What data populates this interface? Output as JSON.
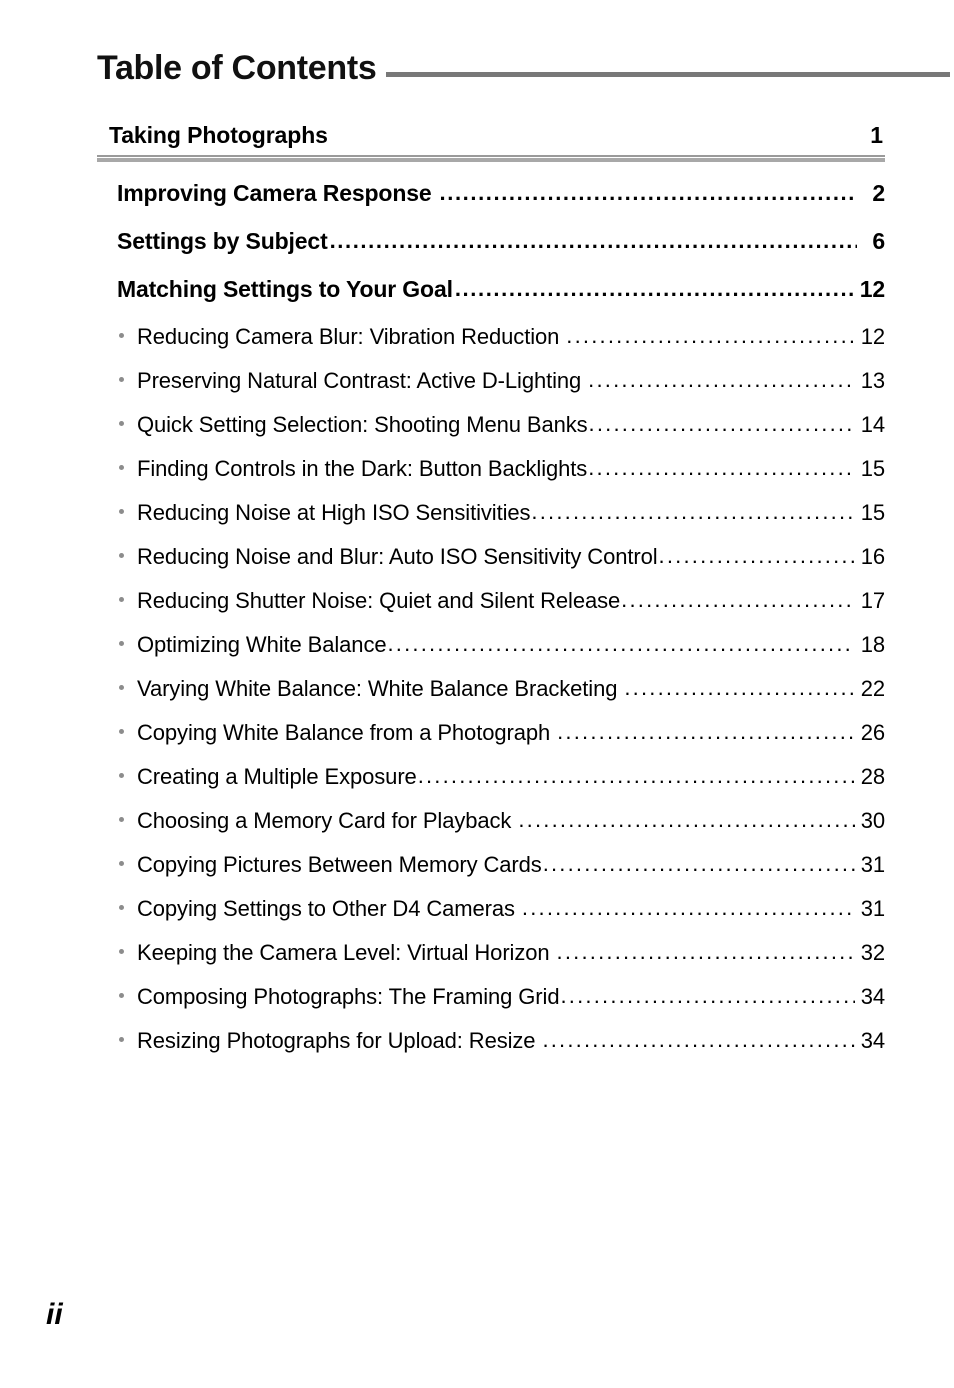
{
  "document": {
    "title": "Table of Contents",
    "folio": "ii"
  },
  "colors": {
    "header_rule": "#787878",
    "section_rule_thin": "#9a9a9a",
    "section_rule_thick": "#a8a8a8",
    "bullet": "#8c8c8c",
    "text": "#000000",
    "background": "#ffffff"
  },
  "section": {
    "title": "Taking Photographs",
    "page": "1"
  },
  "entries": [
    {
      "level": 2,
      "label": "Improving Camera Response",
      "page": "2",
      "gap": true
    },
    {
      "level": 2,
      "label": "Settings by Subject",
      "page": "6",
      "gap": false
    },
    {
      "level": 2,
      "label": "Matching Settings to Your Goal",
      "page": "12",
      "gap": false
    },
    {
      "level": 3,
      "label": "Reducing Camera Blur: Vibration Reduction",
      "page": "12",
      "gap": true
    },
    {
      "level": 3,
      "label": "Preserving Natural Contrast: Active D-Lighting",
      "page": "13",
      "gap": true
    },
    {
      "level": 3,
      "label": "Quick Setting Selection: Shooting Menu Banks",
      "page": "14",
      "gap": false
    },
    {
      "level": 3,
      "label": "Finding Controls in the Dark: Button Backlights",
      "page": "15",
      "gap": false
    },
    {
      "level": 3,
      "label": "Reducing Noise at High ISO Sensitivities",
      "page": "15",
      "gap": false
    },
    {
      "level": 3,
      "label": "Reducing Noise and Blur: Auto ISO Sensitivity Control",
      "page": "16",
      "gap": false
    },
    {
      "level": 3,
      "label": "Reducing Shutter Noise: Quiet and Silent Release",
      "page": "17",
      "gap": false
    },
    {
      "level": 3,
      "label": "Optimizing White Balance",
      "page": "18",
      "gap": false
    },
    {
      "level": 3,
      "label": "Varying White Balance: White Balance Bracketing",
      "page": "22",
      "gap": true
    },
    {
      "level": 3,
      "label": "Copying White Balance from a Photograph",
      "page": "26",
      "gap": true
    },
    {
      "level": 3,
      "label": "Creating a Multiple Exposure",
      "page": "28",
      "gap": false
    },
    {
      "level": 3,
      "label": "Choosing a Memory Card for Playback",
      "page": "30",
      "gap": true
    },
    {
      "level": 3,
      "label": "Copying Pictures Between Memory Cards",
      "page": "31",
      "gap": false
    },
    {
      "level": 3,
      "label": "Copying Settings to Other D4 Cameras",
      "page": "31",
      "gap": true
    },
    {
      "level": 3,
      "label": "Keeping the Camera Level: Virtual Horizon",
      "page": "32",
      "gap": true
    },
    {
      "level": 3,
      "label": "Composing Photographs: The Framing Grid",
      "page": "34",
      "gap": false
    },
    {
      "level": 3,
      "label": "Resizing Photographs for Upload: Resize",
      "page": "34",
      "gap": true
    }
  ]
}
